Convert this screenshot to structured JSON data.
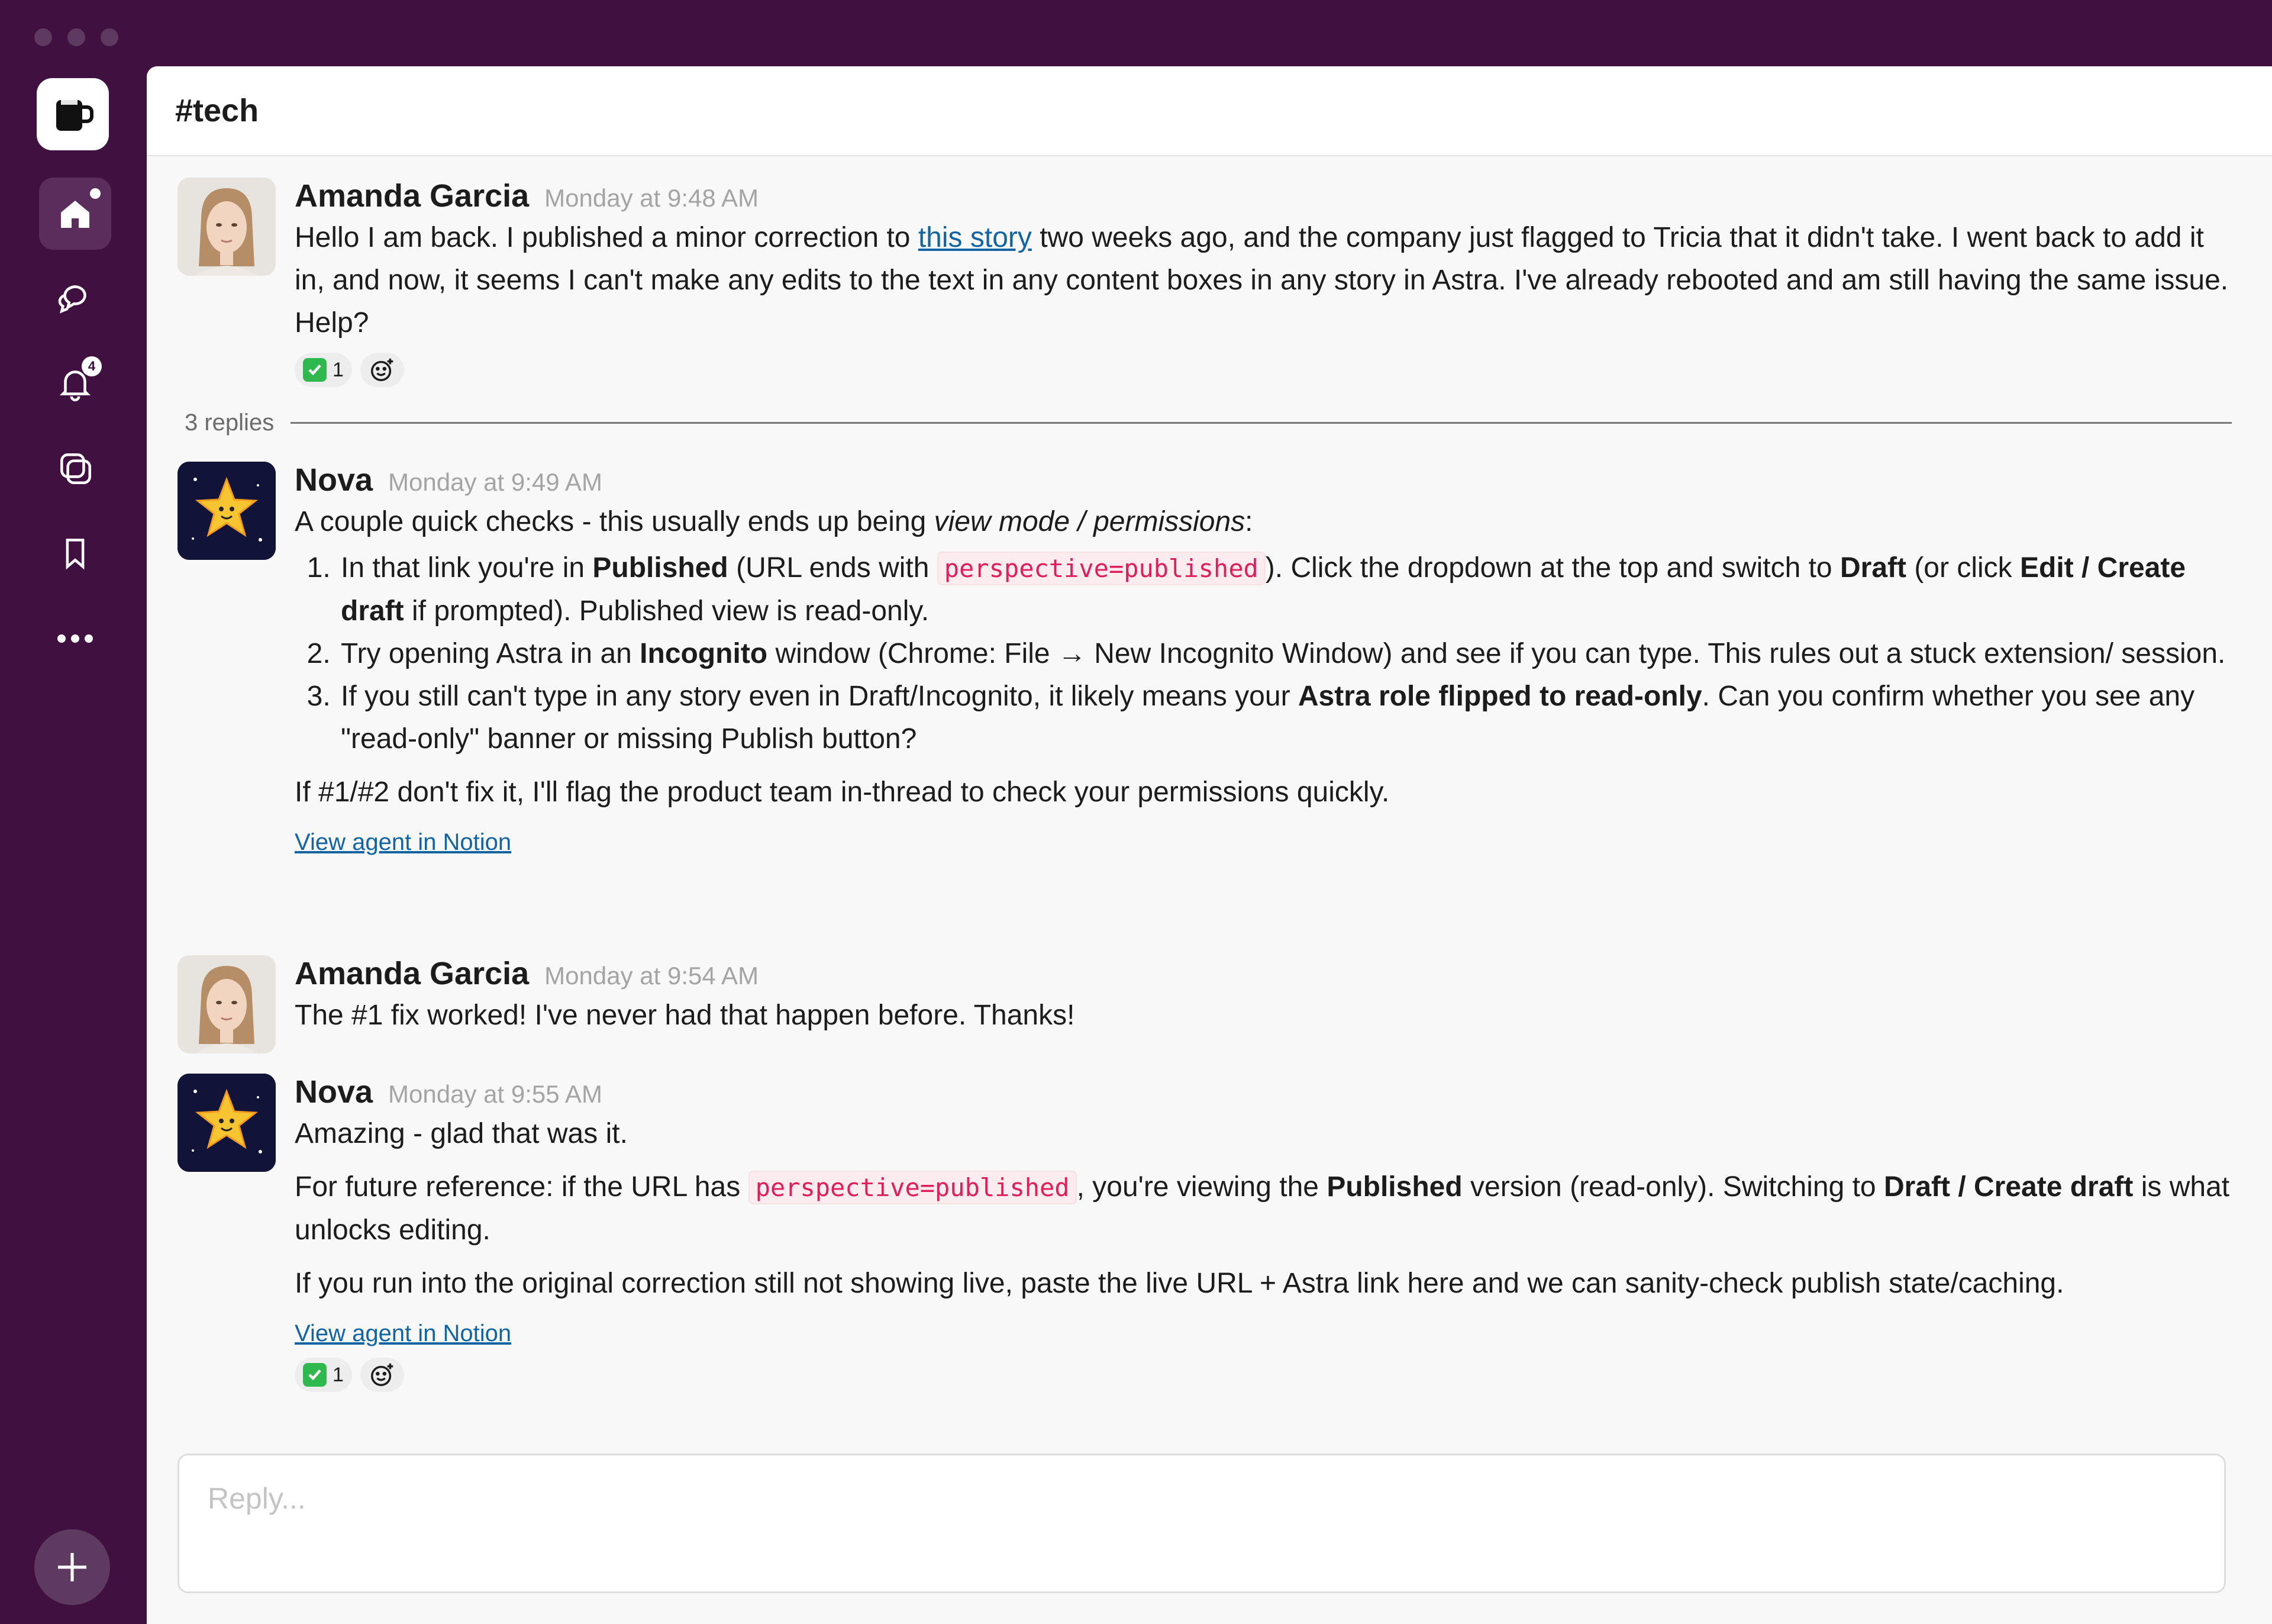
{
  "window": {
    "controls": [
      "close",
      "minimize",
      "zoom"
    ]
  },
  "sidebar": {
    "workspace_icon": "mug-icon",
    "items": [
      {
        "name": "home",
        "icon": "home-icon",
        "active": true,
        "dot": true
      },
      {
        "name": "threads",
        "icon": "chat-bubbles-icon"
      },
      {
        "name": "activity",
        "icon": "bell-icon",
        "badge": "4"
      },
      {
        "name": "dms",
        "icon": "copy-icon"
      },
      {
        "name": "saved",
        "icon": "bookmark-icon"
      },
      {
        "name": "more",
        "icon": "ellipsis-icon"
      }
    ],
    "add_icon": "plus-icon"
  },
  "channel": {
    "title": "#tech"
  },
  "messages": {
    "m1": {
      "author": "Amanda Garcia",
      "time": "Monday at 9:48 AM",
      "text_before": "Hello I am back. I published a minor correction to ",
      "link": "this story",
      "text_after": " two weeks ago, and the company just flagged to Tricia that it didn't take. I went back to add it in, and now, it seems I can't make any edits to the text in any content boxes in any story in Astra. I've already rebooted and am still having the same issue. Help?",
      "reaction_count": "1"
    },
    "replies": "3 replies",
    "m2": {
      "author": "Nova",
      "time": "Monday at 9:49 AM",
      "intro": "A couple quick checks - this usually ends up being ",
      "intro_em": "view mode / permissions",
      "intro_end": ":",
      "s1_a": "In that link you're in ",
      "s1_b": "Published",
      "s1_c": " (URL ends with ",
      "s1_code": "perspective=published",
      "s1_d": "). Click the dropdown at the top and switch to ",
      "s1_e": "Draft",
      "s1_f": " (or click ",
      "s1_g": "Edit / Create draft",
      "s1_h": " if prompted). Published view is read-only.",
      "s2_a": "Try opening Astra in an ",
      "s2_b": "Incognito",
      "s2_c": " window (Chrome: File → New Incognito Window) and see if you can type. This rules out a stuck extension/ session.",
      "s3_a": "If you still can't type in any story even in Draft/Incognito, it likely means your ",
      "s3_b": "Astra role flipped to read-only",
      "s3_c": ". Can you confirm whether you see any \"read-only\" banner or missing Publish button?",
      "outro": "If #1/#2 don't fix it, I'll flag the product team in-thread to check your permissions quickly.",
      "view_link": "View agent in Notion"
    },
    "m3": {
      "author": "Amanda Garcia",
      "time": "Monday at 9:54 AM",
      "text": "The #1 fix worked! I've never had that happen before. Thanks!"
    },
    "m4": {
      "author": "Nova",
      "time": "Monday at 9:55 AM",
      "p1": "Amazing - glad that was it.",
      "p2_a": "For future reference: if the URL has ",
      "p2_code": "perspective=published",
      "p2_b": ", you're viewing the ",
      "p2_c": "Published",
      "p2_d": " version (read-only). Switching to ",
      "p2_e": "Draft / Create draft",
      "p2_f": " is what unlocks editing.",
      "p3": "If you run into the original correction still not showing live, paste the live URL + Astra link here and we can sanity-check publish state/caching.",
      "view_link": "View agent in Notion",
      "reaction_count": "1"
    }
  },
  "composer": {
    "placeholder": "Reply..."
  },
  "colors": {
    "sidebar": "#3f1040",
    "link": "#1264a3",
    "code": "#e01e5a",
    "check": "#2fb84e"
  }
}
